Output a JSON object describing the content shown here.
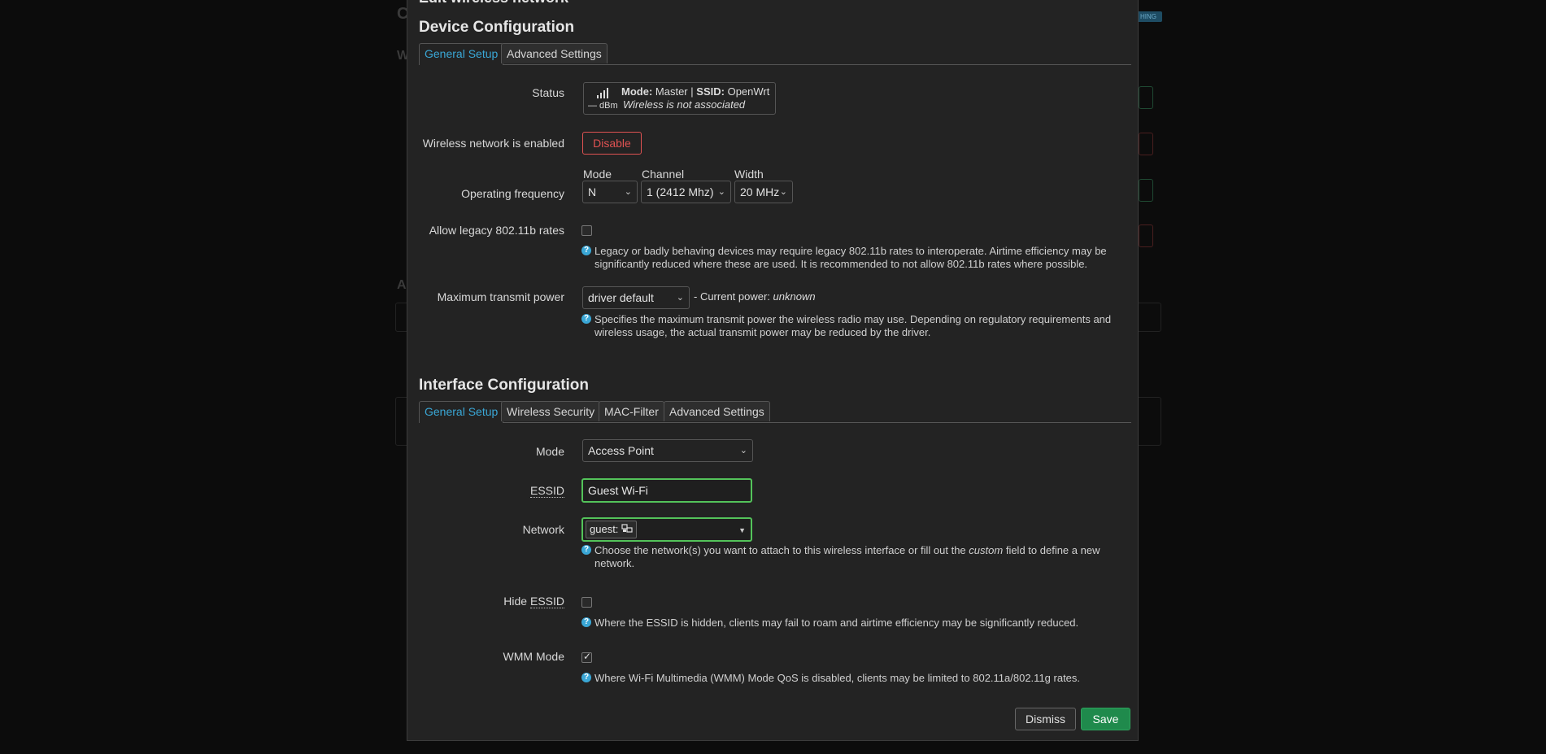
{
  "modal": {
    "title": "Edit wireless network"
  },
  "device": {
    "section_title": "Device Configuration",
    "tabs": [
      "General Setup",
      "Advanced Settings"
    ],
    "status": {
      "label": "Status",
      "mode_key": "Mode:",
      "mode_value": "Master",
      "separator": "|",
      "ssid_key": "SSID:",
      "ssid_value": "OpenWrt",
      "signal": "— dBm",
      "association": "Wireless is not associated"
    },
    "enabled": {
      "label": "Wireless network is enabled",
      "button": "Disable"
    },
    "frequency": {
      "label": "Operating frequency",
      "mode_label": "Mode",
      "mode_value": "N",
      "channel_label": "Channel",
      "channel_value": "1 (2412 Mhz)",
      "width_label": "Width",
      "width_value": "20 MHz"
    },
    "legacy": {
      "label": "Allow legacy 802.11b rates",
      "checked": false,
      "help": "Legacy or badly behaving devices may require legacy 802.11b rates to interoperate. Airtime efficiency may be significantly reduced where these are used. It is recommended to not allow 802.11b rates where possible."
    },
    "txpower": {
      "label": "Maximum transmit power",
      "value": "driver default",
      "current_prefix": "- Current power:",
      "current_value": "unknown",
      "help": "Specifies the maximum transmit power the wireless radio may use. Depending on regulatory requirements and wireless usage, the actual transmit power may be reduced by the driver."
    }
  },
  "iface": {
    "section_title": "Interface Configuration",
    "tabs": [
      "General Setup",
      "Wireless Security",
      "MAC-Filter",
      "Advanced Settings"
    ],
    "mode": {
      "label": "Mode",
      "value": "Access Point"
    },
    "essid": {
      "label": "ESSID",
      "value": "Guest Wi-Fi"
    },
    "network": {
      "label": "Network",
      "value": "guest:",
      "help_before": "Choose the network(s) you want to attach to this wireless interface or fill out the",
      "help_em": "custom",
      "help_after": "field to define a new network."
    },
    "hide": {
      "label_prefix": "Hide",
      "label_abbr": "ESSID",
      "checked": false,
      "help": "Where the ESSID is hidden, clients may fail to roam and airtime efficiency may be significantly reduced."
    },
    "wmm": {
      "label": "WMM Mode",
      "checked": true,
      "help": "Where Wi-Fi Multimedia (WMM) Mode QoS is disabled, clients may be limited to 802.11a/802.11g rates."
    }
  },
  "footer": {
    "dismiss": "Dismiss",
    "save": "Save"
  },
  "background": {
    "badge": "HING"
  },
  "colors": {
    "accent": "#3aa7d6",
    "danger": "#e05252",
    "success": "#2fa35d",
    "valid": "#53c35a"
  }
}
